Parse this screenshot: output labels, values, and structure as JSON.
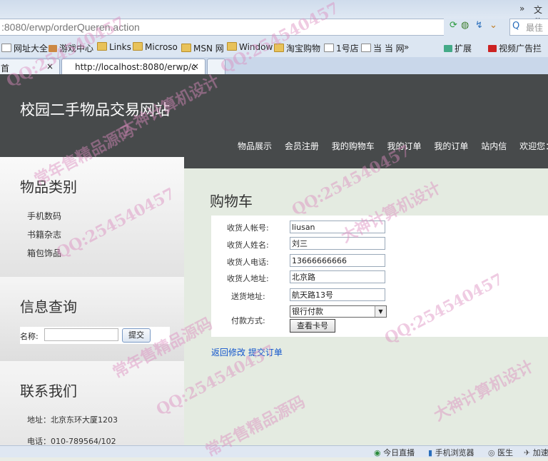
{
  "browser": {
    "more": "»",
    "file_menu": "文件",
    "url": ":8080/erwp/orderQueren.action",
    "search_placeholder": "最佳",
    "favorites": [
      "网址大全",
      "游戏中心",
      "Links",
      "Microso",
      "MSN 网",
      "Window",
      "淘宝购物",
      "1号店",
      "当 当 网",
      "»",
      "扩展",
      "视频广告拦"
    ],
    "tabs": [
      {
        "label": "首",
        "close": "×"
      },
      {
        "label": "http://localhost:8080/erwp/c",
        "close": "×"
      }
    ]
  },
  "site": {
    "title": "校园二手物品交易网站",
    "nav": [
      "物品展示",
      "会员注册",
      "我的购物车",
      "我的订单",
      "我的订单",
      "站内信",
      "欢迎您：刘三"
    ]
  },
  "sidebar": {
    "categories_title": "物品类别",
    "categories": [
      "手机数码",
      "书籍杂志",
      "箱包饰品"
    ],
    "query_title": "信息查询",
    "query_label": "名称:",
    "query_value": "",
    "query_button": "提交",
    "contact_title": "联系我们",
    "contact_address": "地址：北京东环大厦1203",
    "contact_phone": "电话：010-789564/102"
  },
  "main": {
    "heading": "购物车",
    "fields": [
      {
        "label": "收货人帐号:",
        "value": "liusan"
      },
      {
        "label": "收货人姓名:",
        "value": "刘三"
      },
      {
        "label": "收货人电话:",
        "value": "13666666666"
      },
      {
        "label": "收货人地址:",
        "value": "北京路"
      },
      {
        "label": "送货地址:",
        "value": "航天路13号"
      }
    ],
    "payment_label": "付款方式:",
    "payment_value": "银行付款",
    "card_button": "查看卡号",
    "back_link": "返回修改",
    "submit_link": "提交订单"
  },
  "statusbar": {
    "items": [
      "今日直播",
      "手机浏览器",
      "医生",
      "加速器"
    ]
  },
  "watermarks": [
    "QQ:254540457",
    "大神计算机设计",
    "常年售精品源码"
  ]
}
